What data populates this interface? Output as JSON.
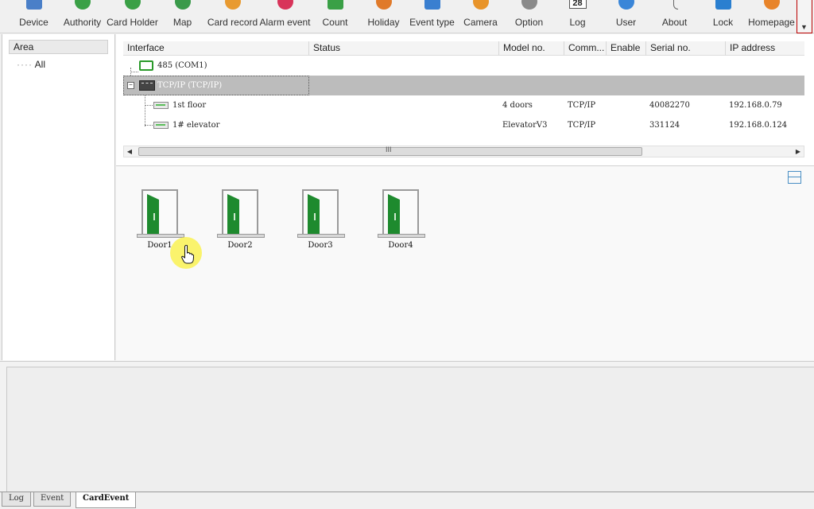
{
  "toolbar": {
    "items": [
      {
        "label": "Device",
        "icon": "device-icon",
        "color": "#4a7fc8"
      },
      {
        "label": "Authority",
        "icon": "authority-icon",
        "color": "#3aa046"
      },
      {
        "label": "Card Holder",
        "icon": "card-holder-icon",
        "color": "#3aa046"
      },
      {
        "label": "Map",
        "icon": "map-icon",
        "color": "#3a9a4a"
      },
      {
        "label": "Card record",
        "icon": "card-record-icon",
        "color": "#e89a30"
      },
      {
        "label": "Alarm event",
        "icon": "alarm-event-icon",
        "color": "#d8345a"
      },
      {
        "label": "Count",
        "icon": "count-icon",
        "color": "#3aa046"
      },
      {
        "label": "Holiday",
        "icon": "holiday-icon",
        "color": "#e07a2a"
      },
      {
        "label": "Event type",
        "icon": "event-type-icon",
        "color": "#3a7fd0"
      },
      {
        "label": "Camera",
        "icon": "camera-icon",
        "color": "#e8942a"
      },
      {
        "label": "Option",
        "icon": "option-icon",
        "color": "#8a8a8a"
      },
      {
        "label": "Log",
        "icon": "log-icon",
        "color": "#333333",
        "number": "28"
      },
      {
        "label": "User",
        "icon": "user-icon",
        "color": "#3a86d8"
      },
      {
        "label": "About",
        "icon": "about-icon",
        "color": "#666666"
      },
      {
        "label": "Lock",
        "icon": "lock-icon",
        "color": "#2a7fd0"
      },
      {
        "label": "Homepage",
        "icon": "homepage-icon",
        "color": "#e8842a"
      }
    ]
  },
  "area": {
    "header": "Area",
    "items": [
      "All"
    ]
  },
  "device_list": {
    "columns": [
      "Interface",
      "Status",
      "Model no.",
      "Comm...",
      "Enable",
      "Serial no.",
      "IP address"
    ],
    "rows": [
      {
        "name": "485 (COM1)",
        "model": "",
        "comm": "",
        "serial": "",
        "ip": ""
      },
      {
        "name": "TCP/IP (TCP/IP)",
        "model": "",
        "comm": "",
        "serial": "",
        "ip": ""
      },
      {
        "name": "1st floor",
        "model": "4 doors",
        "comm": "TCP/IP",
        "serial": "40082270",
        "ip": "192.168.0.79"
      },
      {
        "name": "1# elevator",
        "model": "ElevatorV3",
        "comm": "TCP/IP",
        "serial": "331124",
        "ip": "192.168.0.124"
      }
    ],
    "scroll_grip": "III"
  },
  "doors": [
    {
      "label": "Door1"
    },
    {
      "label": "Door2"
    },
    {
      "label": "Door3"
    },
    {
      "label": "Door4"
    }
  ],
  "tabs": [
    "Log",
    "Event",
    "CardEvent"
  ]
}
